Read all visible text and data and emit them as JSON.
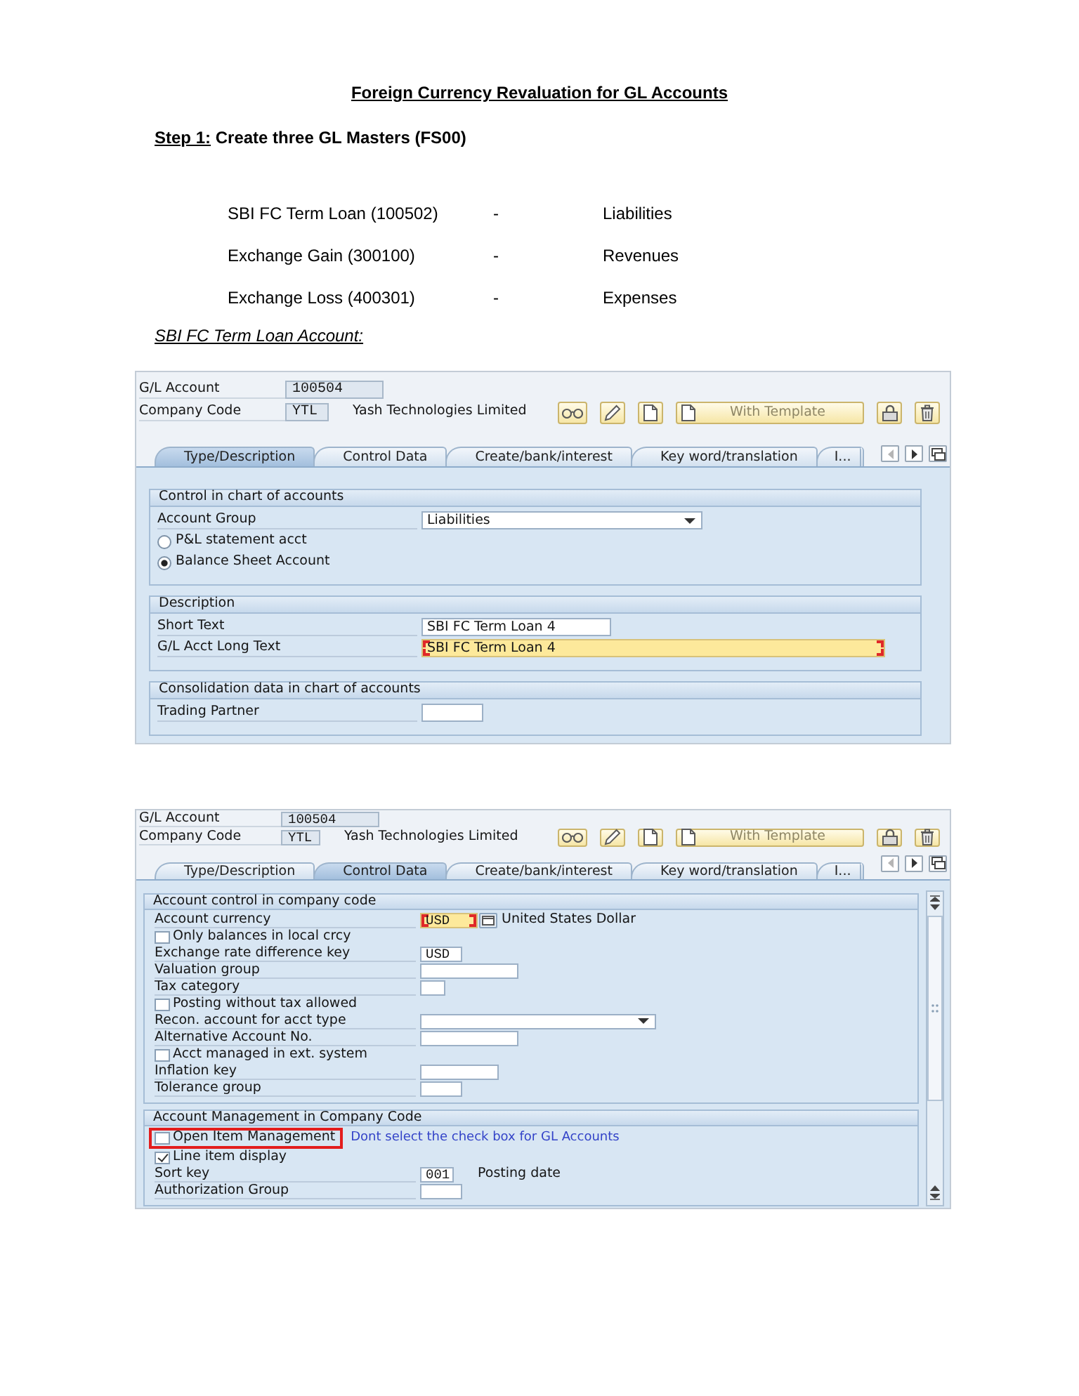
{
  "document": {
    "title": "Foreign Currency Revaluation for GL Accounts",
    "step_label": "Step 1:",
    "step_text": "Create three GL Masters (FS00)",
    "gl_masters": [
      {
        "name": "SBI FC Term Loan (100502)",
        "separator": "-",
        "group": "Liabilities"
      },
      {
        "name": "Exchange Gain (300100)",
        "separator": "-",
        "group": "Revenues"
      },
      {
        "name": "Exchange Loss (400301)",
        "separator": "-",
        "group": "Expenses"
      }
    ],
    "caption": "SBI FC Term Loan Account:"
  },
  "screens": [
    {
      "header": {
        "gl_account": {
          "label": "G/L Account",
          "value": "100504"
        },
        "company_code": {
          "label": "Company Code",
          "value": "YTL",
          "description": "Yash Technologies Limited"
        }
      },
      "toolbar": [
        {
          "kind": "display"
        },
        {
          "kind": "change"
        },
        {
          "kind": "create"
        },
        {
          "kind": "template",
          "label": "With Template"
        },
        {
          "kind": "block"
        },
        {
          "kind": "delete"
        }
      ],
      "tabs": [
        {
          "label": "Type/Description",
          "selected": true
        },
        {
          "label": "Control Data",
          "selected": false
        },
        {
          "label": "Create/bank/interest",
          "selected": false
        },
        {
          "label": "Key word/translation",
          "selected": false
        },
        {
          "label": "I...",
          "selected": false
        }
      ],
      "scrollbar": false,
      "panels": [
        {
          "title": "Control in chart of accounts",
          "rows": [
            {
              "kind": "dropdown",
              "label": "Account Group",
              "value": "Liabilities"
            },
            {
              "kind": "radio",
              "label": "P&L statement acct",
              "selected": false
            },
            {
              "kind": "radio",
              "label": "Balance Sheet Account",
              "selected": true
            }
          ]
        },
        {
          "title": "Description",
          "rows": [
            {
              "kind": "field",
              "label": "Short Text",
              "value": "SBI FC Term Loan 4",
              "focused": false
            },
            {
              "kind": "field",
              "label": "G/L Acct Long Text",
              "value": "SBI FC Term Loan 4",
              "focused": true
            }
          ]
        },
        {
          "title": "Consolidation data in chart of accounts",
          "rows": [
            {
              "kind": "field",
              "label": "Trading Partner",
              "focused": false
            }
          ]
        }
      ]
    },
    {
      "header": {
        "gl_account": {
          "label": "G/L Account",
          "value": "100504"
        },
        "company_code": {
          "label": "Company Code",
          "value": "YTL",
          "description": "Yash Technologies Limited"
        }
      },
      "toolbar": [
        {
          "kind": "display"
        },
        {
          "kind": "change"
        },
        {
          "kind": "create"
        },
        {
          "kind": "template",
          "label": "With Template"
        },
        {
          "kind": "block"
        },
        {
          "kind": "delete"
        }
      ],
      "tabs": [
        {
          "label": "Type/Description",
          "selected": false
        },
        {
          "label": "Control Data",
          "selected": true
        },
        {
          "label": "Create/bank/interest",
          "selected": false
        },
        {
          "label": "Key word/translation",
          "selected": false
        },
        {
          "label": "I...",
          "selected": false
        }
      ],
      "scrollbar": true,
      "panels": [
        {
          "title": "Account control in company code",
          "rows": [
            {
              "kind": "field",
              "label": "Account currency",
              "value": "USD",
              "focused": true,
              "value_help": true,
              "description": "United States Dollar"
            },
            {
              "kind": "checkbox",
              "label": "Only balances in local crcy",
              "checked": false
            },
            {
              "kind": "field",
              "label": "Exchange rate difference key",
              "value": "USD",
              "focused": false
            },
            {
              "kind": "field",
              "label": "Valuation group",
              "focused": false
            },
            {
              "kind": "field",
              "label": "Tax category",
              "focused": false
            },
            {
              "kind": "checkbox",
              "label": "Posting without tax allowed",
              "checked": false
            },
            {
              "kind": "dropdown",
              "label": "Recon. account for acct type"
            },
            {
              "kind": "field",
              "label": "Alternative Account No.",
              "focused": false
            },
            {
              "kind": "checkbox",
              "label": "Acct managed in ext. system",
              "checked": false
            },
            {
              "kind": "field",
              "label": "Inflation key",
              "focused": false
            },
            {
              "kind": "field",
              "label": "Tolerance group",
              "focused": false
            }
          ]
        },
        {
          "title": "Account Management in Company Code",
          "rows": [
            {
              "kind": "checkbox",
              "label": "Open Item Management",
              "checked": false,
              "highlighted": true,
              "note": "Dont select the check box for GL Accounts"
            },
            {
              "kind": "checkbox",
              "label": "Line item display",
              "checked": true
            },
            {
              "kind": "field",
              "label": "Sort key",
              "value": "001",
              "focused": false,
              "description": "Posting date"
            },
            {
              "kind": "field",
              "label": "Authorization Group",
              "focused": false
            }
          ]
        }
      ]
    }
  ]
}
